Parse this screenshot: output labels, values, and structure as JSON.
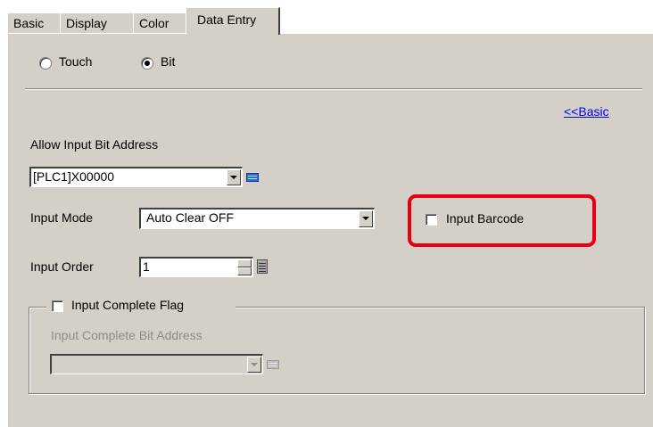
{
  "tabs": [
    {
      "label": "Basic"
    },
    {
      "label": "Display"
    },
    {
      "label": "Color"
    },
    {
      "label": "Data Entry",
      "active": true
    }
  ],
  "mode": {
    "touch_label": "Touch",
    "bit_label": "Bit",
    "selected": "Bit"
  },
  "basic_link": "<<Basic",
  "allow_input_bit_address": {
    "label": "Allow Input Bit Address",
    "value": "[PLC1]X00000"
  },
  "input_mode": {
    "label": "Input Mode",
    "value": "Auto Clear OFF"
  },
  "input_barcode": {
    "label": "Input Barcode",
    "checked": false
  },
  "input_order": {
    "label": "Input Order",
    "value": "1"
  },
  "input_complete_flag": {
    "label": "Input Complete Flag",
    "checked": false
  },
  "input_complete_bit_address": {
    "label": "Input Complete Bit Address",
    "value": ""
  },
  "colors": {
    "panel": "#d4d0c8",
    "highlight": "#e60012",
    "link": "#0000ff"
  }
}
